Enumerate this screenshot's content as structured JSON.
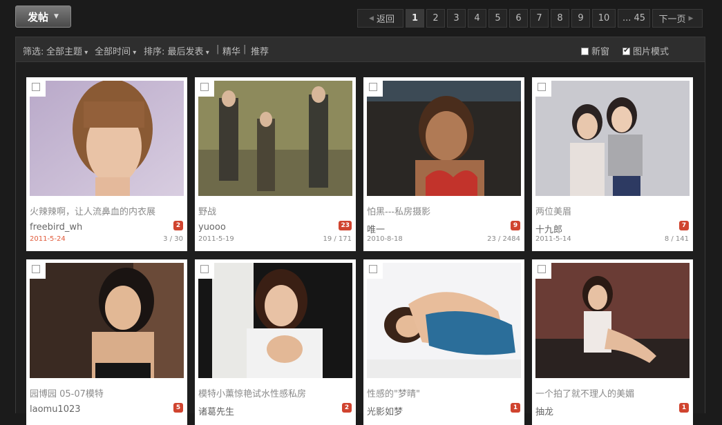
{
  "toolbar": {
    "post_label": "发帖"
  },
  "pager": {
    "prev": "返回",
    "pages": [
      "1",
      "2",
      "3",
      "4",
      "5",
      "6",
      "7",
      "8",
      "9",
      "10"
    ],
    "last": "... 45",
    "next": "下一页",
    "current": "1"
  },
  "filter": {
    "label": "筛选:",
    "topic": "全部主题",
    "time": "全部时间",
    "sort": "排序: 最后发表",
    "digest": "精华",
    "recommend": "推荐",
    "new_window": "新窗",
    "image_mode": "图片模式",
    "image_mode_checked": true,
    "new_window_checked": false
  },
  "posts": [
    {
      "title": "火辣辣啊，让人流鼻血的内衣展",
      "author": "freebird_wh",
      "badge": "2",
      "date": "2011-5-24",
      "stats": "3 / 30",
      "date_new": true
    },
    {
      "title": "野战",
      "author": "yuooo",
      "badge": "23",
      "date": "2011-5-19",
      "stats": "19 / 171",
      "date_new": false
    },
    {
      "title": "怕黑---私房摄影",
      "author": "唯一",
      "badge": "9",
      "date": "2010-8-18",
      "stats": "23 / 2484",
      "date_new": false
    },
    {
      "title": "两位美眉",
      "author": "十九郎",
      "badge": "7",
      "date": "2011-5-14",
      "stats": "8 / 141",
      "date_new": false
    },
    {
      "title": "园博园 05-07模特",
      "author": "laomu1023",
      "badge": "5",
      "date": "",
      "stats": "",
      "date_new": false
    },
    {
      "title": "模特小薰惊艳试水性感私房",
      "author": "诸葛先生",
      "badge": "2",
      "date": "",
      "stats": "",
      "date_new": false
    },
    {
      "title": "性感的\"梦晴\"",
      "author": "光影如梦",
      "badge": "1",
      "date": "",
      "stats": "",
      "date_new": false
    },
    {
      "title": "一个拍了就不理人的美媚",
      "author": "抽龙",
      "badge": "1",
      "date": "",
      "stats": "",
      "date_new": false
    }
  ]
}
